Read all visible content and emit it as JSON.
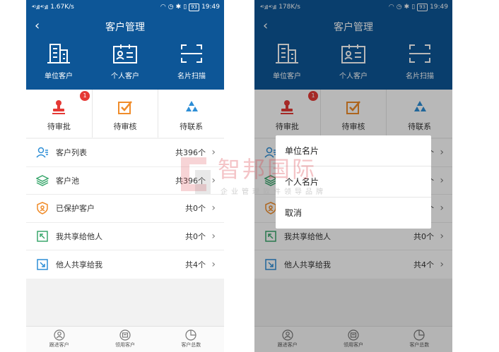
{
  "status_left": {
    "signal": "⁴ᴳ.ıll ⁴ᴳ.ıll",
    "speed": "1.67K/s",
    "battery": "93",
    "time": "19:49"
  },
  "status_right": {
    "signal": "⁴ᴳ.ıll ⁴ᴳ.ıll",
    "speed": "178K/s",
    "battery": "93",
    "time": "19:49"
  },
  "header": {
    "back": "‹",
    "title": "客户管理",
    "items": [
      {
        "label": "单位客户",
        "icon": "building-icon"
      },
      {
        "label": "个人客户",
        "icon": "id-card-icon"
      },
      {
        "label": "名片扫描",
        "icon": "scan-icon"
      }
    ]
  },
  "tasks": {
    "items": [
      {
        "label": "待审批",
        "icon": "stamp-icon",
        "badge": "1"
      },
      {
        "label": "待审核",
        "icon": "checkbox-icon"
      },
      {
        "label": "待联系",
        "icon": "recycle-icon"
      }
    ]
  },
  "list": {
    "chevron": "›",
    "items": [
      {
        "label": "客户列表",
        "count": "共396个",
        "icon": "users-icon"
      },
      {
        "label": "客户池",
        "count": "共396个",
        "icon": "layers-icon"
      },
      {
        "label": "已保护客户",
        "count": "共0个",
        "icon": "shield-icon"
      },
      {
        "label": "我共享给他人",
        "count": "共0个",
        "icon": "share-out-icon"
      },
      {
        "label": "他人共享给我",
        "count": "共4个",
        "icon": "share-in-icon"
      }
    ]
  },
  "tabbar": {
    "items": [
      {
        "label": "跟进客户",
        "icon": "follow-icon"
      },
      {
        "label": "领用客户",
        "icon": "claim-icon"
      },
      {
        "label": "客户总数",
        "icon": "pie-icon"
      }
    ]
  },
  "sheet": {
    "options": [
      "单位名片",
      "个人名片",
      "取消"
    ]
  },
  "watermark": {
    "title": "智邦国际",
    "subtitle": "企业管理软件领导品牌"
  },
  "colors": {
    "header_bg": "#0d5697",
    "badge": "#e53935",
    "accent_orange": "#f08c2a",
    "accent_blue": "#2d8ed6",
    "accent_green": "#3aa76d"
  }
}
